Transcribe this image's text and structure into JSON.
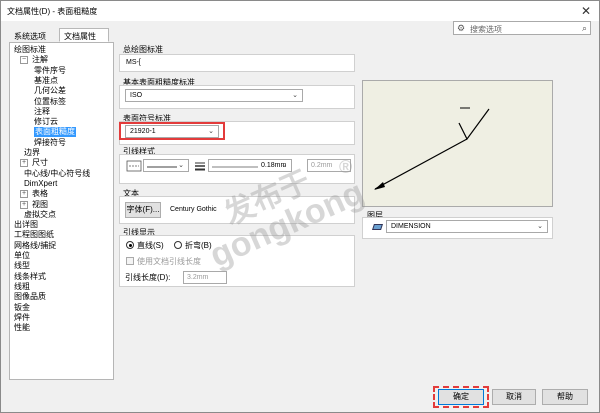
{
  "window": {
    "title": "文档属性(D) - 表面粗糙度",
    "close_glyph": "✕"
  },
  "tabs": [
    {
      "label": "系统选项(S)",
      "active": false
    },
    {
      "label": "文档属性(D)",
      "active": true
    }
  ],
  "search": {
    "placeholder": "搜索选项",
    "gear_icon": "gear-icon",
    "search_icon": "search-icon"
  },
  "tree": [
    {
      "label": "绘图标准",
      "expander": ""
    },
    {
      "label": "注解",
      "expander": "−"
    },
    {
      "label": "零件序号",
      "expander": ""
    },
    {
      "label": "基准点",
      "expander": ""
    },
    {
      "label": "几何公差",
      "expander": ""
    },
    {
      "label": "位置标签",
      "expander": ""
    },
    {
      "label": "注释",
      "expander": ""
    },
    {
      "label": "修订云",
      "expander": ""
    },
    {
      "label": "表面粗糙度",
      "expander": "",
      "selected": true
    },
    {
      "label": "焊接符号",
      "expander": ""
    },
    {
      "label": "边界",
      "expander": ""
    },
    {
      "label": "尺寸",
      "expander": "+"
    },
    {
      "label": "中心线/中心符号线",
      "expander": ""
    },
    {
      "label": "DimXpert",
      "expander": ""
    },
    {
      "label": "表格",
      "expander": "+"
    },
    {
      "label": "视图",
      "expander": "+"
    },
    {
      "label": "虚拟交点",
      "expander": ""
    },
    {
      "label": "出详图",
      "expander": ""
    },
    {
      "label": "工程图图纸",
      "expander": ""
    },
    {
      "label": "网格线/捕捉",
      "expander": ""
    },
    {
      "label": "单位",
      "expander": ""
    },
    {
      "label": "线型",
      "expander": ""
    },
    {
      "label": "线条样式",
      "expander": ""
    },
    {
      "label": "线粗",
      "expander": ""
    },
    {
      "label": "图像品质",
      "expander": ""
    },
    {
      "label": "钣金",
      "expander": ""
    },
    {
      "label": "焊件",
      "expander": ""
    },
    {
      "label": "性能",
      "expander": ""
    }
  ],
  "overall_standard": {
    "label": "总绘图标准",
    "value": "MS-[",
    "note": ""
  },
  "base_standard": {
    "label": "基本表面粗糙度标准",
    "value": "ISO"
  },
  "symbol_standard": {
    "label": "表面符号标准",
    "value": "21920-1"
  },
  "leader_style": {
    "label": "引线样式",
    "thickness": "0.18mm",
    "custom_thickness": "0.2mm"
  },
  "text": {
    "label": "文本",
    "font_button": "字体(F)...",
    "font_name": "Century Gothic"
  },
  "leader_display": {
    "label": "引线显示",
    "straight_label": "直线(S)",
    "bent_label": "折弯(B)",
    "use_doc_length": "使用文档引线长度",
    "length_label": "引线长度(D):",
    "length_value": "3.2mm"
  },
  "layer": {
    "label": "图层",
    "value": "DIMENSION"
  },
  "buttons": {
    "ok": "确定",
    "cancel": "取消",
    "help": "帮助"
  },
  "watermark": {
    "line1": "发布于",
    "line2": "gongkong",
    "reg": "®"
  },
  "colors": {
    "highlight": "#e33b3b",
    "selection": "#3399ff"
  }
}
